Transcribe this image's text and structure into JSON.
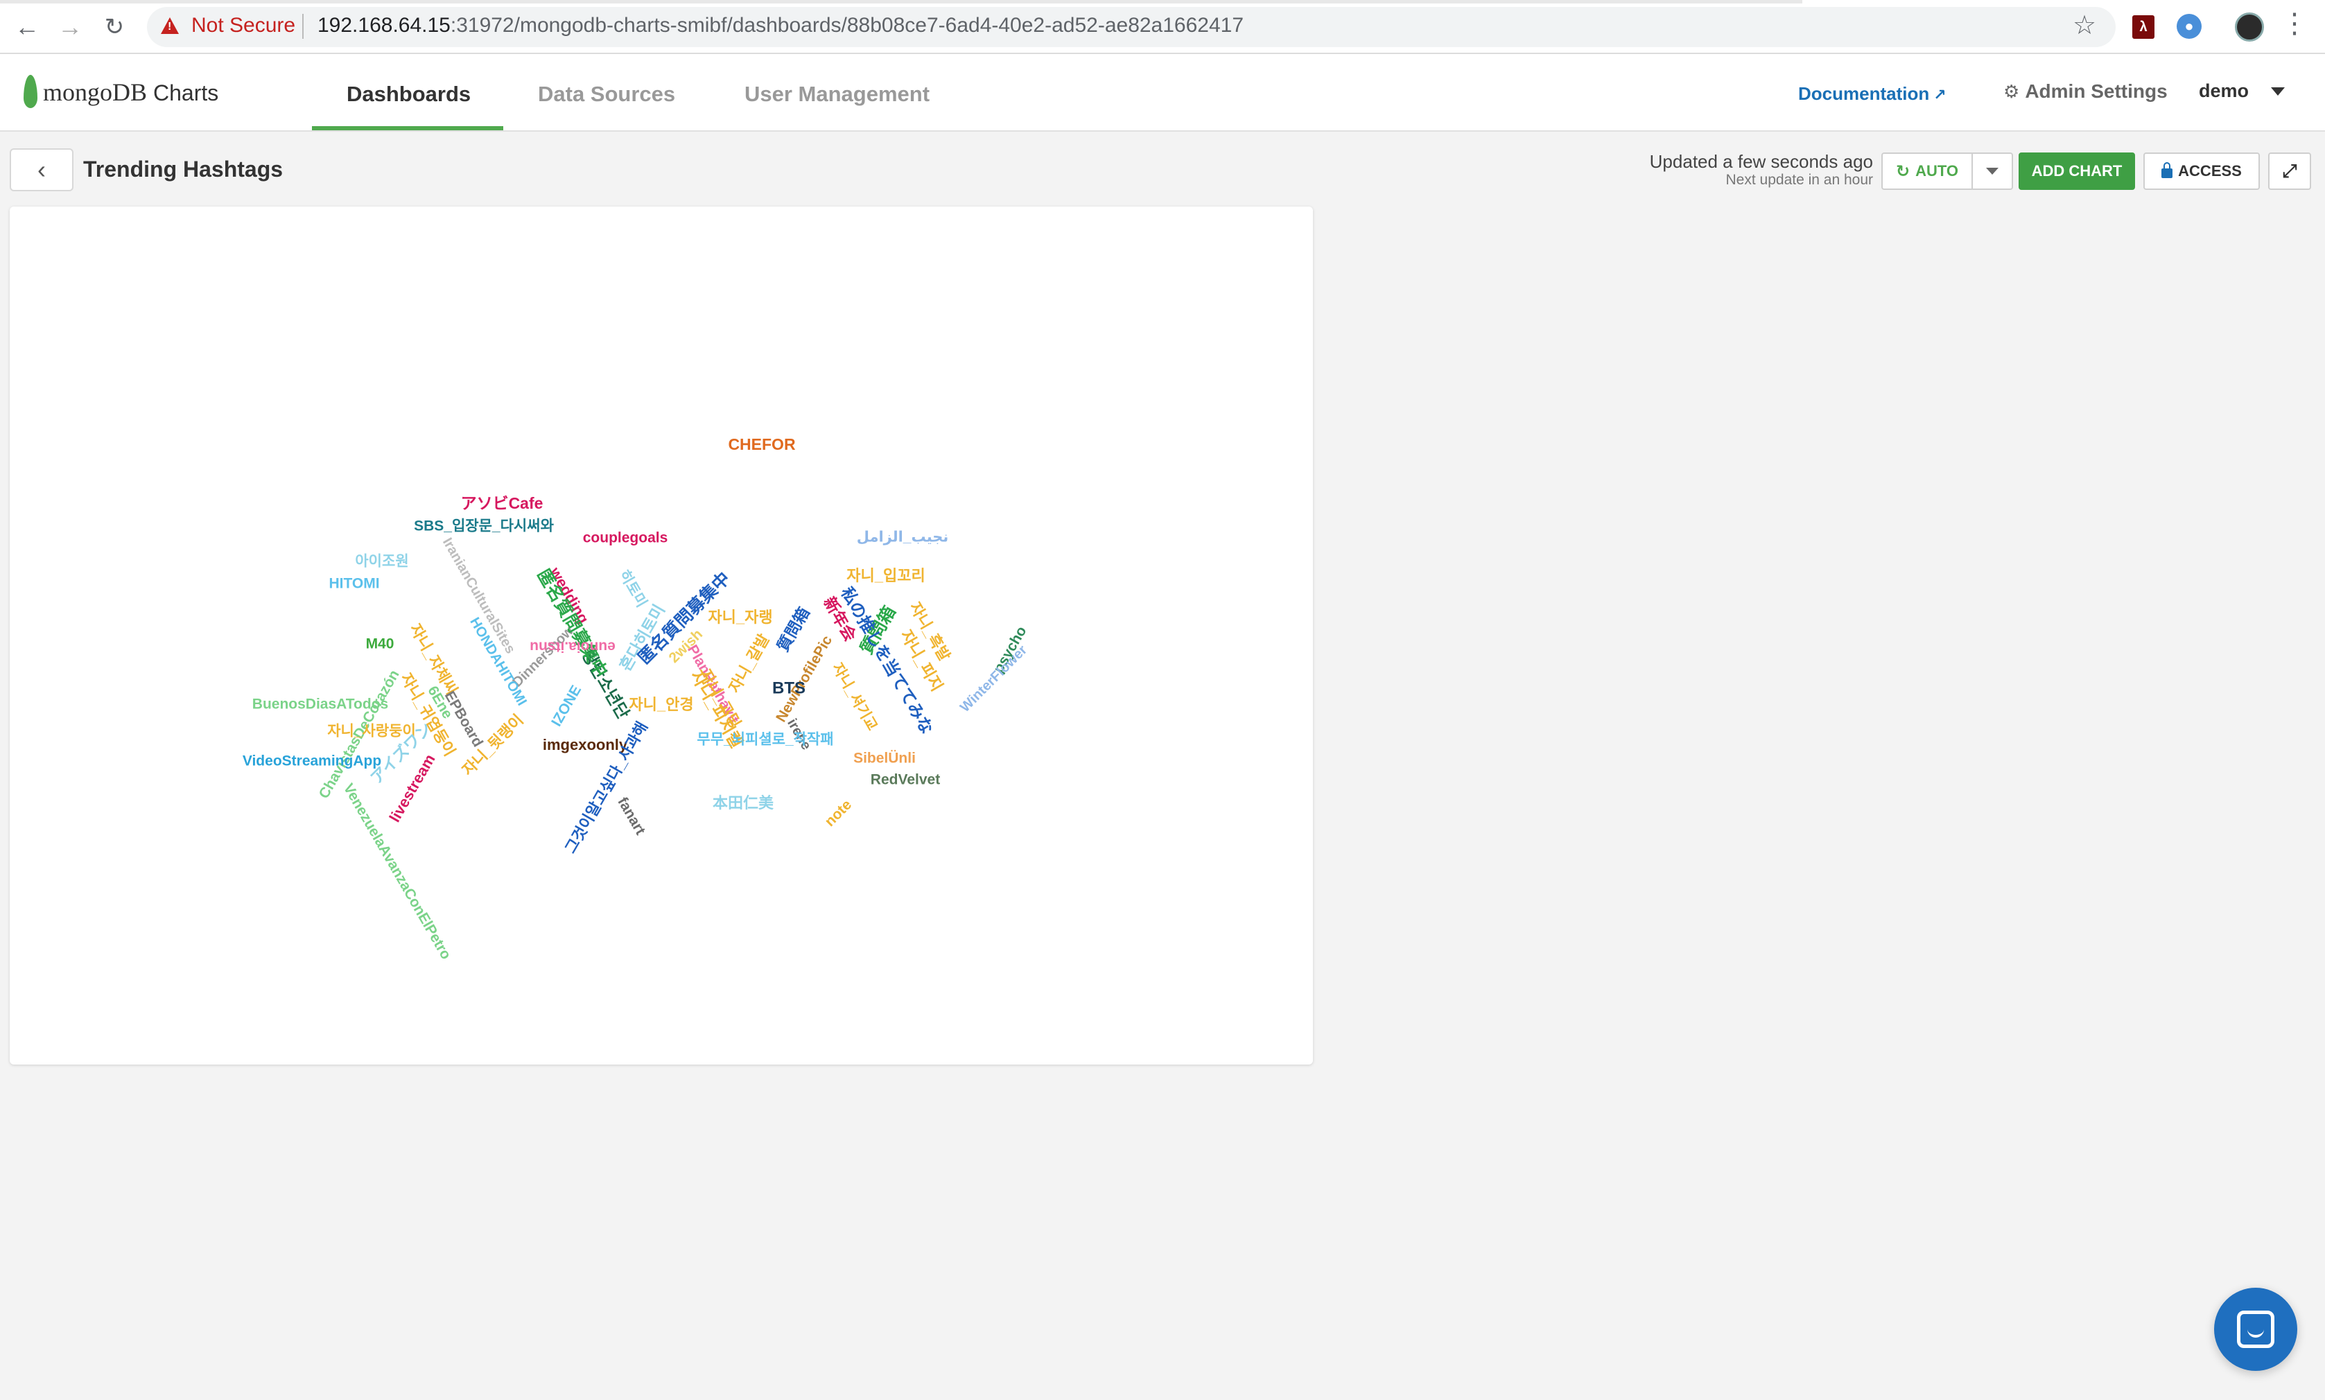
{
  "browser": {
    "security_label": "Not Secure",
    "url_host": "192.168.64.15",
    "url_rest": ":31972/mongodb-charts-smibf/dashboards/88b08ce7-6ad4-40e2-ad52-ae82a1662417",
    "icons": [
      "back-arrow-icon",
      "forward-arrow-icon",
      "reload-icon",
      "warning-icon",
      "bookmark-star-icon",
      "pdf-extension-icon",
      "extension-drop-icon",
      "profile-avatar-icon",
      "chrome-menu-icon"
    ]
  },
  "app": {
    "brand_mongo": "mongoDB",
    "brand_charts": "Charts",
    "nav": [
      {
        "label": "Dashboards",
        "active": true
      },
      {
        "label": "Data Sources",
        "active": false
      },
      {
        "label": "User Management",
        "active": false
      }
    ],
    "documentation": "Documentation",
    "admin_settings": "Admin Settings",
    "user": "demo",
    "accent_color": "#4fa94d"
  },
  "dashboard": {
    "title": "Trending Hashtags",
    "updated": "Updated a few seconds ago",
    "next_update": "Next update in an hour",
    "auto_label": "AUTO",
    "add_chart_label": "ADD CHART",
    "access_label": "ACCESS"
  },
  "chart_data": {
    "type": "wordcloud",
    "words": [
      {
        "text": "ChavistasDeCorazón",
        "color": "#7bd389",
        "rotation": -60
      },
      {
        "text": "6Ene",
        "color": "#7bd389",
        "rotation": 60
      },
      {
        "text": "Dinnershow",
        "color": "#9a9a9a",
        "rotation": -45
      },
      {
        "text": "방탄소년단",
        "color": "#1b6b4a",
        "rotation": 60
      },
      {
        "text": "PlanRathavit",
        "color": "#f06ca6",
        "rotation": 60
      },
      {
        "text": "CHEFOR",
        "color": "#e06a1f",
        "rotation": 0
      },
      {
        "text": "NewProfilePic",
        "color": "#c8872e",
        "rotation": -60
      },
      {
        "text": "자니_피지켈",
        "color": "#f0b430",
        "rotation": 60
      },
      {
        "text": "irene",
        "color": "#6b6b6b",
        "rotation": 60
      },
      {
        "text": "アソビCafe",
        "color": "#d6185f",
        "rotation": 0
      },
      {
        "text": "SBS_입장문_다시써와",
        "color": "#1a7a8a",
        "rotation": 0
      },
      {
        "text": "couplegoals",
        "color": "#d6185f",
        "rotation": 0
      },
      {
        "text": "نجيب_الزامل",
        "color": "#8fb7e8",
        "rotation": 0
      },
      {
        "text": "아이조원",
        "color": "#8fd3e8",
        "rotation": 0
      },
      {
        "text": "HITOMI",
        "color": "#5bc0eb",
        "rotation": 0
      },
      {
        "text": "IranianCulturalSites",
        "color": "#bdbdbd",
        "rotation": 60
      },
      {
        "text": "wedding",
        "color": "#d6185f",
        "rotation": 60
      },
      {
        "text": "히토미",
        "color": "#8fd3e8",
        "rotation": 60
      },
      {
        "text": "자니_입꼬리",
        "color": "#f0b430",
        "rotation": 0
      },
      {
        "text": "匿名質問募集中",
        "color": "#2aa84a",
        "rotation": 60
      },
      {
        "text": "혼다히토미",
        "color": "#8fd3e8",
        "rotation": -60
      },
      {
        "text": "匿名質問募集中",
        "color": "#1f5fbf",
        "rotation": -45
      },
      {
        "text": "新年会",
        "color": "#d6185f",
        "rotation": 60
      },
      {
        "text": "質問箱",
        "color": "#2aa84a",
        "rotation": -60
      },
      {
        "text": "자니_흑발",
        "color": "#f0b430",
        "rotation": 60
      },
      {
        "text": "M40",
        "color": "#3caa3c",
        "rotation": 0
      },
      {
        "text": "자니_자체씨",
        "color": "#f0b430",
        "rotation": 60
      },
      {
        "text": "HONDAHITOMI",
        "color": "#5bc0eb",
        "rotation": 60
      },
      {
        "text": "eunoia.itsnu",
        "color": "#f06ca6",
        "rotation": 180
      },
      {
        "text": "2wish",
        "color": "#f0d060",
        "rotation": -45
      },
      {
        "text": "자니_자랭",
        "color": "#f0b430",
        "rotation": 0
      },
      {
        "text": "質問箱",
        "color": "#1f5fbf",
        "rotation": -60
      },
      {
        "text": "私の推しを当ててみな",
        "color": "#1f5fbf",
        "rotation": 60
      },
      {
        "text": "자니_피지",
        "color": "#f0b430",
        "rotation": 60
      },
      {
        "text": "psycho",
        "color": "#2f8a5a",
        "rotation": -60
      },
      {
        "text": "WinterFlower",
        "color": "#8fb7e8",
        "rotation": -45
      },
      {
        "text": "BuenosDiasATodos",
        "color": "#7bd389",
        "rotation": 0
      },
      {
        "text": "EPBoard",
        "color": "#7a7a7a",
        "rotation": 60
      },
      {
        "text": "자니_귀엽둥이",
        "color": "#f0b430",
        "rotation": 60
      },
      {
        "text": "IZONE",
        "color": "#5bc0eb",
        "rotation": -60
      },
      {
        "text": "자니_안경",
        "color": "#f0b430",
        "rotation": 0
      },
      {
        "text": "자니_갈발",
        "color": "#f0b430",
        "rotation": -60
      },
      {
        "text": "자니_고딩",
        "color": "#f0b430",
        "rotation": 60
      },
      {
        "text": "BTS",
        "color": "#1b3b5a",
        "rotation": 0
      },
      {
        "text": "자니_사랑둥이",
        "color": "#f0b430",
        "rotation": 0
      },
      {
        "text": "자니_셔기교",
        "color": "#f0b430",
        "rotation": 60
      },
      {
        "text": "VideoStreamingApp",
        "color": "#29a3d9",
        "rotation": 0
      },
      {
        "text": "アイズワン",
        "color": "#8fd3e8",
        "rotation": -45
      },
      {
        "text": "자니_뒷랭이",
        "color": "#f0b430",
        "rotation": -45
      },
      {
        "text": "imgexoonly",
        "color": "#5a2a0a",
        "rotation": 0
      },
      {
        "text": "무무_뇌피셜로_작작패",
        "color": "#5bc0eb",
        "rotation": 0
      },
      {
        "text": "SibelÜnli",
        "color": "#f0a050",
        "rotation": 0
      },
      {
        "text": "RedVelvet",
        "color": "#5a7a5a",
        "rotation": 0
      },
      {
        "text": "livestream",
        "color": "#d6185f",
        "rotation": -60
      },
      {
        "text": "그것이알고싶다_사과해",
        "color": "#1f5fbf",
        "rotation": -60
      },
      {
        "text": "fanart",
        "color": "#6b6b6b",
        "rotation": 60
      },
      {
        "text": "本田仁美",
        "color": "#8fd3e8",
        "rotation": 0
      },
      {
        "text": "note",
        "color": "#f0b430",
        "rotation": -45
      },
      {
        "text": "VenezuelaAvanzaConElPetro",
        "color": "#7bd389",
        "rotation": 60
      }
    ]
  }
}
